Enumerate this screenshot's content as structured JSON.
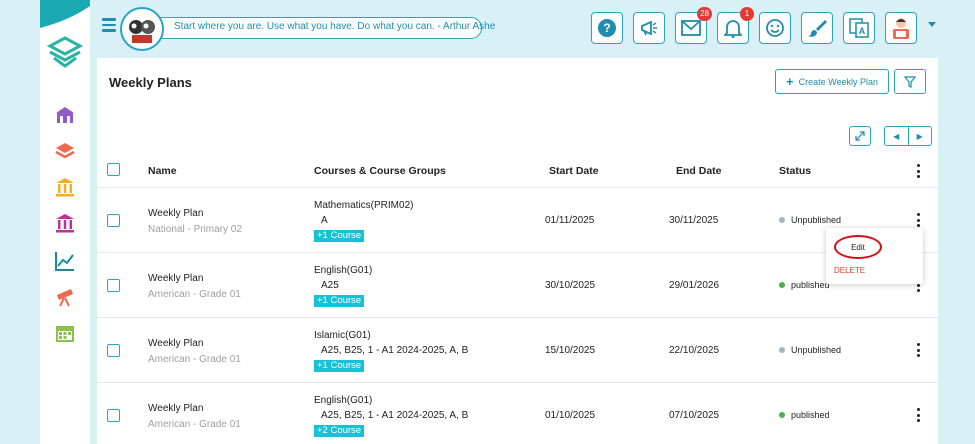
{
  "topbar": {
    "quote": "Start where you are. Use what you have. Do what you can. - Arthur Ashe",
    "mail_badge": "28",
    "notification_badge": "1"
  },
  "page": {
    "title": "Weekly Plans",
    "create_label": "Create Weekly Plan"
  },
  "table": {
    "headers": {
      "name": "Name",
      "courses": "Courses & Course Groups",
      "start": "Start Date",
      "end": "End Date",
      "status": "Status"
    },
    "rows": [
      {
        "name": "Weekly Plan",
        "sub": "National - Primary 02",
        "course": "Mathematics(PRIM02)",
        "groups": "A",
        "tag": "+1 Course",
        "start": "01/11/2025",
        "end": "30/11/2025",
        "status": "Unpublished",
        "status_color": "#a7b3c2"
      },
      {
        "name": "Weekly Plan",
        "sub": "American - Grade 01",
        "course": "English(G01)",
        "groups": "A25",
        "tag": "+1 Course",
        "start": "30/10/2025",
        "end": "29/01/2026",
        "status": "published",
        "status_color": "#4caf50"
      },
      {
        "name": "Weekly Plan",
        "sub": "American - Grade 01",
        "course": "Islamic(G01)",
        "groups": "A25, B25, 1 - A1 2024-2025, A, B",
        "tag": "+1 Course",
        "start": "15/10/2025",
        "end": "22/10/2025",
        "status": "Unpublished",
        "status_color": "#a7b3c2"
      },
      {
        "name": "Weekly Plan",
        "sub": "American - Grade 01",
        "course": "English(G01)",
        "groups": "A25, B25, 1 - A1 2024-2025, A, B",
        "tag": "+2 Course",
        "start": "01/10/2025",
        "end": "07/10/2025",
        "status": "published",
        "status_color": "#4caf50"
      }
    ]
  },
  "dropdown": {
    "edit": "Edit",
    "delete": "DELETE"
  },
  "colors": {
    "accent": "#27a4c5",
    "tag": "#18c2d6",
    "danger": "#e53935",
    "background": "#d9f1f6"
  }
}
